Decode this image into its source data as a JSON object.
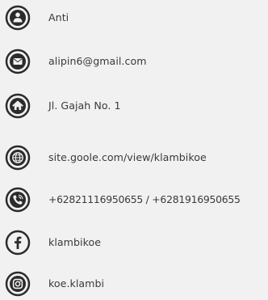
{
  "contacts": [
    {
      "type": "name",
      "icon": "user-icon",
      "text": "Anti"
    },
    {
      "type": "email",
      "icon": "envelope-icon",
      "text": "alipin6@gmail.com"
    },
    {
      "type": "address",
      "icon": "home-icon",
      "text": "Jl. Gajah No. 1"
    },
    {
      "type": "website",
      "icon": "globe-icon",
      "text": "site.goole.com/view/klambikoe"
    },
    {
      "type": "phone",
      "icon": "phone-icon",
      "text": "+62821116950655 / +6281916950655"
    },
    {
      "type": "facebook",
      "icon": "facebook-icon",
      "text": "klambikoe"
    },
    {
      "type": "instagram",
      "icon": "instagram-icon",
      "text": "koe.klambi"
    }
  ],
  "colors": {
    "icon": "#2b2b2b",
    "text": "#3a3a3a",
    "background": "#f1f1f1"
  }
}
